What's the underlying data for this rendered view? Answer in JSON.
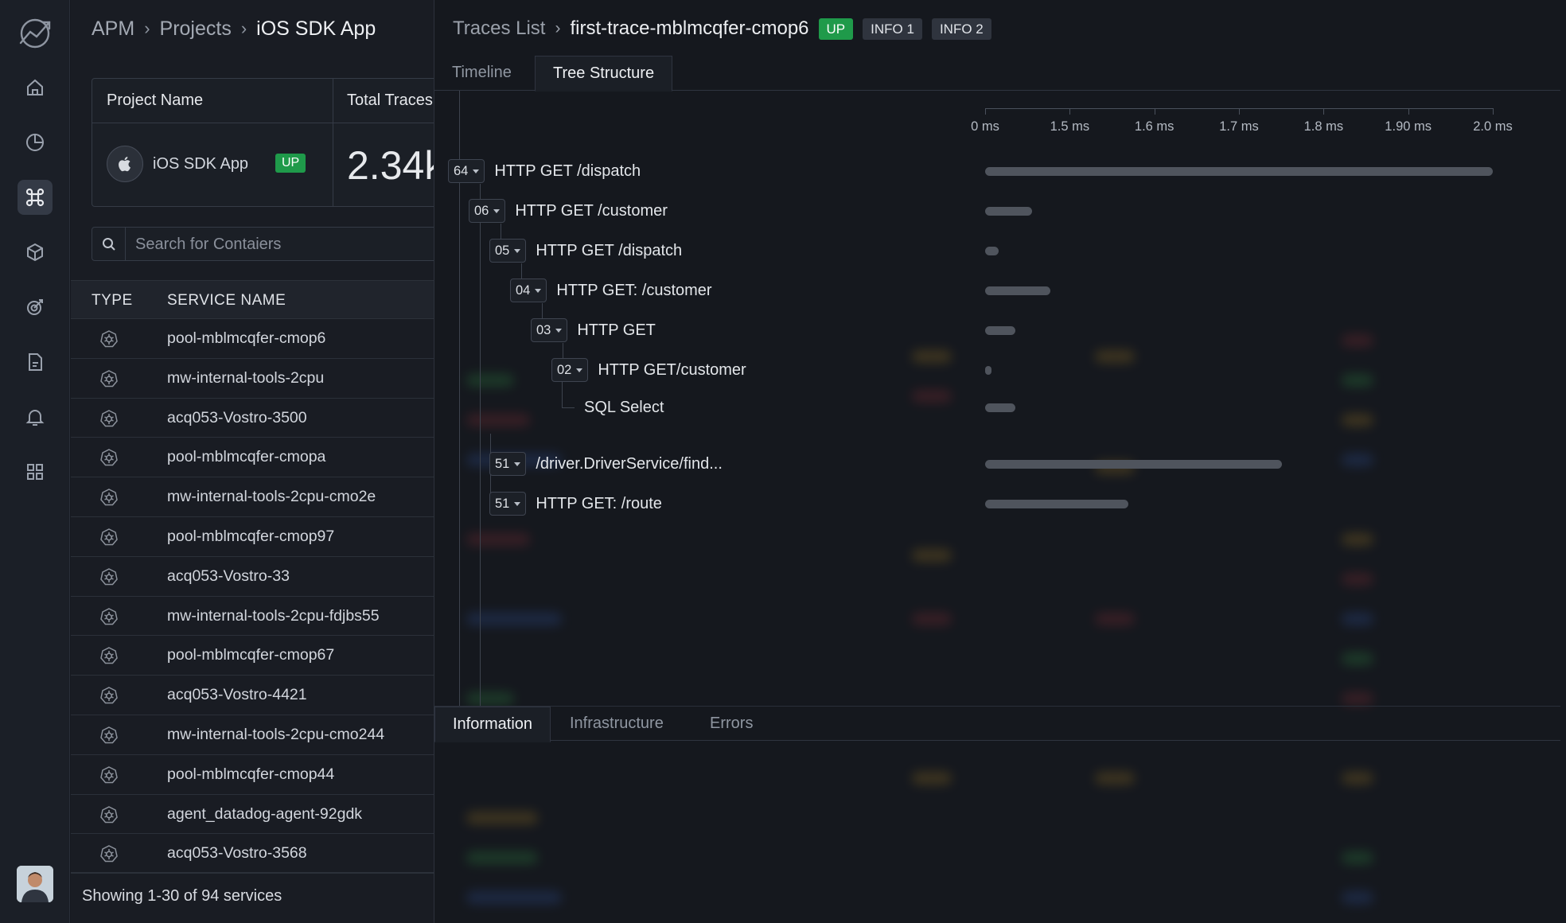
{
  "breadcrumb": {
    "items": [
      "APM",
      "Projects",
      "iOS SDK App"
    ]
  },
  "project_card": {
    "col1_header": "Project Name",
    "col2_header": "Total Traces",
    "project_name": "iOS SDK App",
    "status": "UP",
    "total_traces": "2.34k"
  },
  "search": {
    "placeholder": "Search for Contaiers",
    "value": ""
  },
  "services_table": {
    "headers": [
      "TYPE",
      "SERVICE NAME"
    ],
    "rows": [
      "pool-mblmcqfer-cmop6",
      "mw-internal-tools-2cpu",
      "acq053-Vostro-3500",
      "pool-mblmcqfer-cmopa",
      "mw-internal-tools-2cpu-cmo2e",
      "pool-mblmcqfer-cmop97",
      "acq053-Vostro-33",
      "mw-internal-tools-2cpu-fdjbs55",
      "pool-mblmcqfer-cmop67",
      "acq053-Vostro-4421",
      "mw-internal-tools-2cpu-cmo244",
      "pool-mblmcqfer-cmop44",
      "agent_datadog-agent-92gdk",
      "acq053-Vostro-3568"
    ],
    "type_icon": "kubernetes-icon",
    "footer": "Showing 1-30 of 94 services"
  },
  "detail": {
    "breadcrumb": [
      "Traces List",
      "first-trace-mblmcqfer-cmop6"
    ],
    "status": "UP",
    "tags": [
      "INFO 1",
      "INFO 2"
    ],
    "tabs": [
      "Timeline",
      "Tree Structure"
    ],
    "selected_tab": "Tree Structure",
    "axis_ticks": [
      "0 ms",
      "1.5 ms",
      "1.6 ms",
      "1.7 ms",
      "1.8 ms",
      "1.90 ms",
      "2.0 ms"
    ],
    "spans": [
      {
        "count": "64",
        "label": "HTTP GET /dispatch",
        "depth": 0,
        "bar_start": 0.0,
        "bar_end": 1.0
      },
      {
        "count": "06",
        "label": "HTTP GET /customer",
        "depth": 1,
        "bar_start": 0.0,
        "bar_end": 0.092
      },
      {
        "count": "05",
        "label": "HTTP GET /dispatch",
        "depth": 2,
        "bar_start": 0.0,
        "bar_end": 0.027
      },
      {
        "count": "04",
        "label": "HTTP GET: /customer",
        "depth": 3,
        "bar_start": 0.0,
        "bar_end": 0.128
      },
      {
        "count": "03",
        "label": "HTTP GET",
        "depth": 4,
        "bar_start": 0.0,
        "bar_end": 0.059
      },
      {
        "count": "02",
        "label": "HTTP GET/customer",
        "depth": 5,
        "bar_start": 0.0,
        "bar_end": 0.011
      },
      {
        "count": "",
        "label": "SQL Select",
        "depth": 6,
        "bar_start": 0.0,
        "bar_end": 0.059
      },
      {
        "count": "51",
        "label": "/driver.DriverService/find...",
        "depth": 2,
        "bar_start": 0.0,
        "bar_end": 0.585
      },
      {
        "count": "51",
        "label": "HTTP GET: /route",
        "depth": 2,
        "bar_start": 0.0,
        "bar_end": 0.282
      }
    ],
    "bottom_tabs": [
      "Information",
      "Infrastructure",
      "Errors"
    ],
    "bottom_selected": "Information"
  },
  "colors": {
    "status_green": "#1f9a4a",
    "background": "#15181f",
    "bar_gray": "#4f545d"
  },
  "nav_icons": [
    "logo-icon",
    "home-icon",
    "pie-chart-icon",
    "command-icon",
    "cube-icon",
    "target-icon",
    "document-icon",
    "bell-icon",
    "grid-icon"
  ]
}
